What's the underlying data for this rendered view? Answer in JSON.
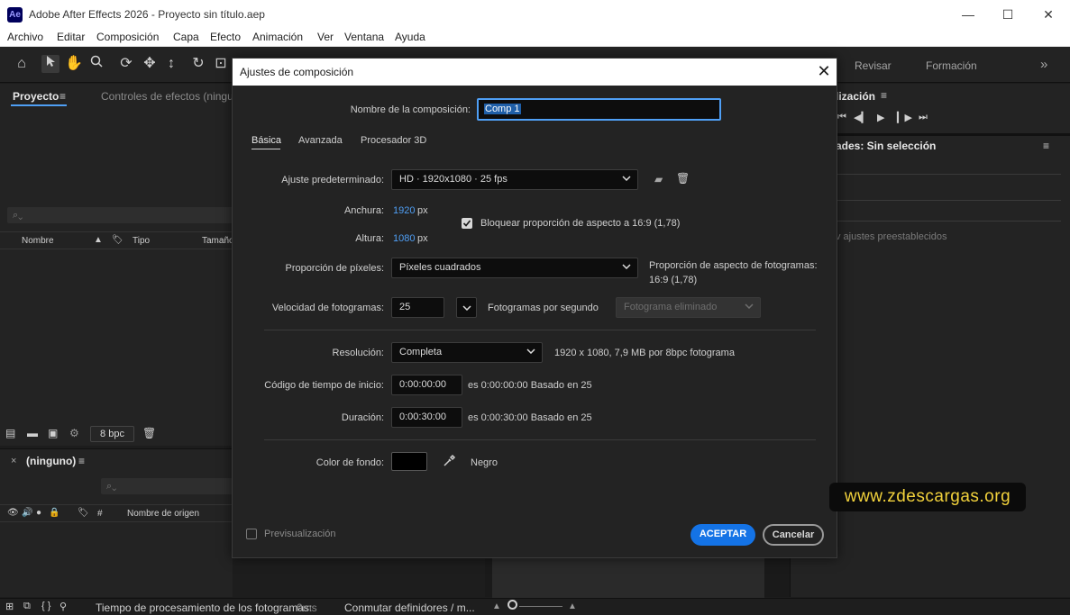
{
  "app": {
    "logo_text": "Ae",
    "window_title": "Adobe After Effects 2026 - Proyecto sin título.aep",
    "minimize": "—",
    "maximize": "☐",
    "close": "✕"
  },
  "menu": [
    "Archivo",
    "Editar",
    "Composición",
    "Capa",
    "Efecto",
    "Animación",
    "Ver",
    "Ventana",
    "Ayuda"
  ],
  "toolbar": {
    "tabs_right": [
      "Revisar",
      "Formación"
    ],
    "more": "»"
  },
  "project_panel": {
    "tab_project": "Proyecto",
    "tab_effects": "Controles de efectos (ninguno",
    "columns": [
      "Nombre",
      "Tipo",
      "Tamaño"
    ],
    "bpc": "8 bpc"
  },
  "timeline_panel": {
    "tab_label": "(ninguno)",
    "columns": [
      "#",
      "Nombre de origen"
    ]
  },
  "right_panel": {
    "preview_title": "lización",
    "props_title": "ades: Sin selección",
    "presets_placeholder": "v ajustes preestablecidos"
  },
  "dialog": {
    "title": "Ajustes de composición",
    "comp_name_label": "Nombre de la composición:",
    "comp_name_value": "Comp 1",
    "tabs": [
      "Básica",
      "Avanzada",
      "Procesador 3D"
    ],
    "preset_label": "Ajuste predeterminado:",
    "preset_value": "HD  ·  1920x1080 · 25 fps",
    "width_label": "Anchura:",
    "width_value": "1920",
    "height_label": "Altura:",
    "height_value": "1080",
    "unit_px": "px",
    "lock_aspect_label": "Bloquear proporción de aspecto a 16:9 (1,78)",
    "lock_aspect_checked": true,
    "pixel_aspect_label": "Proporción de píxeles:",
    "pixel_aspect_value": "Píxeles cuadrados",
    "frame_aspect_label": "Proporción de aspecto de fotogramas:",
    "frame_aspect_value": "16:9 (1,78)",
    "fps_label": "Velocidad de fotogramas:",
    "fps_value": "25",
    "fps_unit": "Fotogramas por segundo",
    "drop_frame_value": "Fotograma eliminado",
    "resolution_label": "Resolución:",
    "resolution_value": "Completa",
    "resolution_info": "1920 x 1080, 7,9 MB por 8bpc fotograma",
    "start_tc_label": "Código de tiempo de inicio:",
    "start_tc_value": "0:00:00:00",
    "start_tc_info": "es 0:00:00:00  Basado en 25",
    "duration_label": "Duración:",
    "duration_value": "0:00:30:00",
    "duration_info": "es 0:00:30:00  Basado en 25",
    "bg_color_label": "Color de fondo:",
    "bg_color_name": "Negro",
    "bg_color_hex": "#000000",
    "preview_label": "Previsualización",
    "ok_label": "ACEPTAR",
    "cancel_label": "Cancelar"
  },
  "watermark": "www.zdescargas.org",
  "status": {
    "render_time_label": "Tiempo de procesamiento de los fotogramas:",
    "render_time_value": "0ms",
    "toggle_label": "Conmutar definidores / m..."
  },
  "colors": {
    "accent": "#1473e6",
    "link": "#4f9ff5",
    "watermark_text": "#f2d23c"
  }
}
